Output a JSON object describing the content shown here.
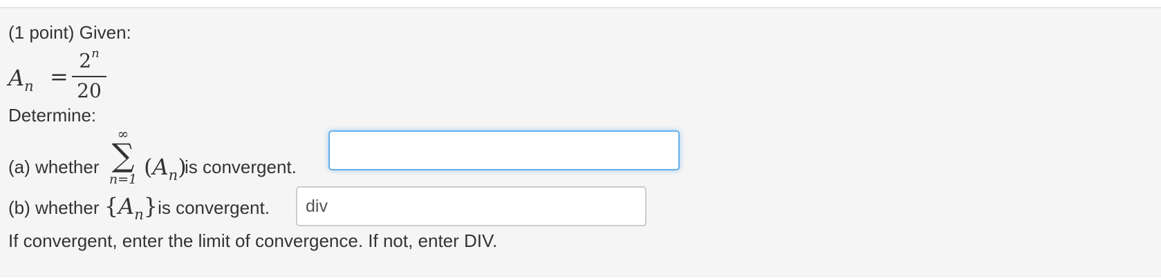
{
  "problem": {
    "intro": "(1 point) Given:",
    "formula": {
      "lhs_base": "A",
      "lhs_sub": "n",
      "eq": "=",
      "numerator_base": "2",
      "numerator_exp": "n",
      "denominator": "20"
    },
    "determine": "Determine:",
    "part_a": {
      "prefix": "(a) whether",
      "sum_upper": "∞",
      "sum_symbol": "∑",
      "sum_lower": "n=1",
      "term_open": "(",
      "term_base": "A",
      "term_sub": "n",
      "term_close": ")",
      "suffix": "is convergent.",
      "answer_value": ""
    },
    "part_b": {
      "prefix": "(b) whether",
      "set_open": "{",
      "set_base": "A",
      "set_sub": "n",
      "set_close": "}",
      "suffix": "is convergent.",
      "answer_value": "div"
    },
    "note": "If convergent, enter the limit of convergence. If not, enter DIV."
  },
  "colors": {
    "panel_bg": "#f5f5f5",
    "text": "#333333",
    "focus_border": "#66afe9",
    "input_border": "#cccccc"
  }
}
